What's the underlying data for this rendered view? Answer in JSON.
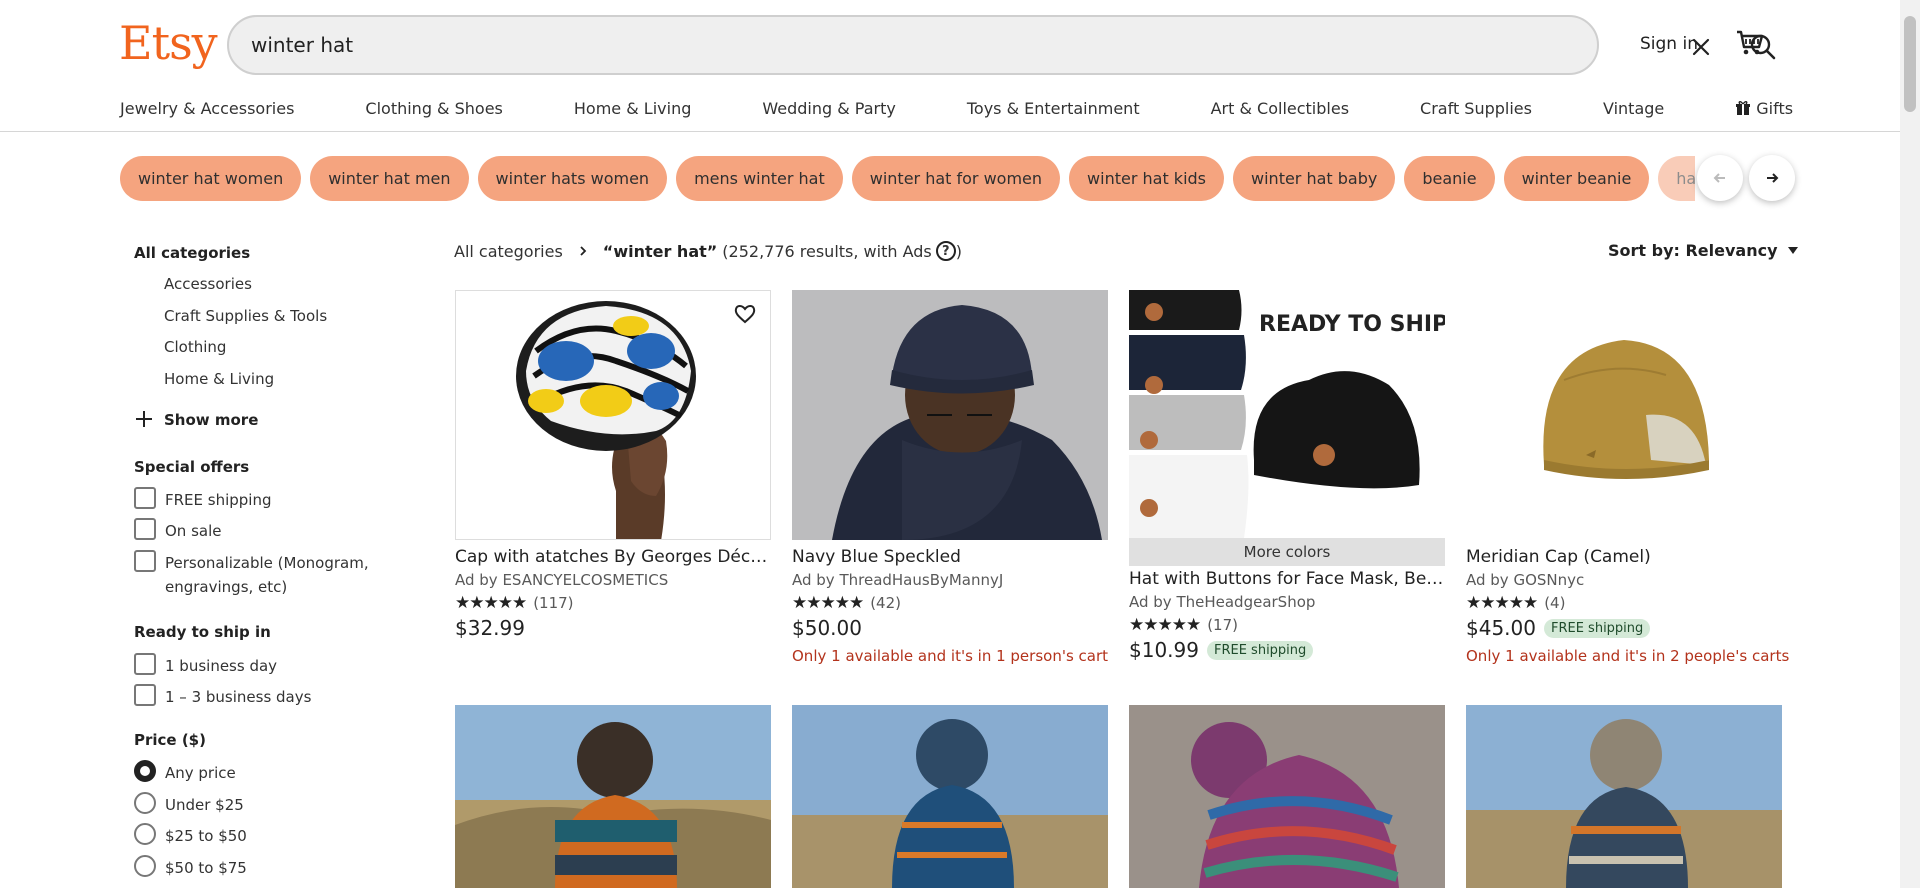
{
  "header": {
    "logo": "Etsy",
    "search_value": "winter hat",
    "signin": "Sign in"
  },
  "nav": [
    {
      "label": "Jewelry & Accessories"
    },
    {
      "label": "Clothing & Shoes"
    },
    {
      "label": "Home & Living"
    },
    {
      "label": "Wedding & Party"
    },
    {
      "label": "Toys & Entertainment"
    },
    {
      "label": "Art & Collectibles"
    },
    {
      "label": "Craft Supplies"
    },
    {
      "label": "Vintage"
    },
    {
      "label": "Gifts"
    }
  ],
  "chips": [
    "winter hat women",
    "winter hat men",
    "winter hats women",
    "mens winter hat",
    "winter hat for women",
    "winter hat kids",
    "winter hat baby",
    "beanie",
    "winter beanie",
    "hat"
  ],
  "sidebar": {
    "categories_title": "All categories",
    "categories": [
      "Accessories",
      "Craft Supplies & Tools",
      "Clothing",
      "Home & Living"
    ],
    "show_more": "Show more",
    "offers_title": "Special offers",
    "offers": [
      "FREE shipping",
      "On sale",
      "Personalizable (Monogram,",
      "engravings, etc)"
    ],
    "ship_title": "Ready to ship in",
    "ship": [
      "1 business day",
      "1 – 3 business days"
    ],
    "price_title": "Price ($)",
    "prices": [
      "Any price",
      "Under $25",
      "$25 to $50",
      "$50 to $75"
    ]
  },
  "results": {
    "breadcrumb_root": "All categories",
    "query": "“winter hat”",
    "count": "(252,776 results, with Ads",
    "close_paren": ")",
    "help": "?",
    "sort": "Sort by: Relevancy"
  },
  "cards": [
    {
      "title": "Cap with atatches By Georges Décimo",
      "shop": "Ad by ESANCYELCOSMETICS",
      "stars": "★★★★★",
      "reviews": "(117)",
      "price": "$32.99",
      "free": "",
      "stock": ""
    },
    {
      "title": "Navy Blue Speckled",
      "shop": "Ad by ThreadHausByMannyJ",
      "stars": "★★★★★",
      "reviews": "(42)",
      "price": "$50.00",
      "free": "",
      "stock": "Only 1 available and it's in 1 person's cart"
    },
    {
      "title": "Hat with Buttons for Face Mask, Beanie",
      "shop": "Ad by TheHeadgearShop",
      "stars": "★★★★★",
      "reviews": "(17)",
      "price": "$10.99",
      "free": "FREE shipping",
      "stock": "",
      "more": "More colors",
      "overlay": "READY TO SHIP"
    },
    {
      "title": "Meridian Cap (Camel)",
      "shop": "Ad by GOSNnyc",
      "stars": "★★★★★",
      "reviews": "(4)",
      "price": "$45.00",
      "free": "FREE shipping",
      "stock": "Only 1 available and it's in 2 people's carts"
    }
  ],
  "colors": {
    "brand": "#F1641E",
    "chip": "#F5A47F",
    "stock_warning": "#B3331C",
    "free_badge": "#D4E9D7"
  }
}
